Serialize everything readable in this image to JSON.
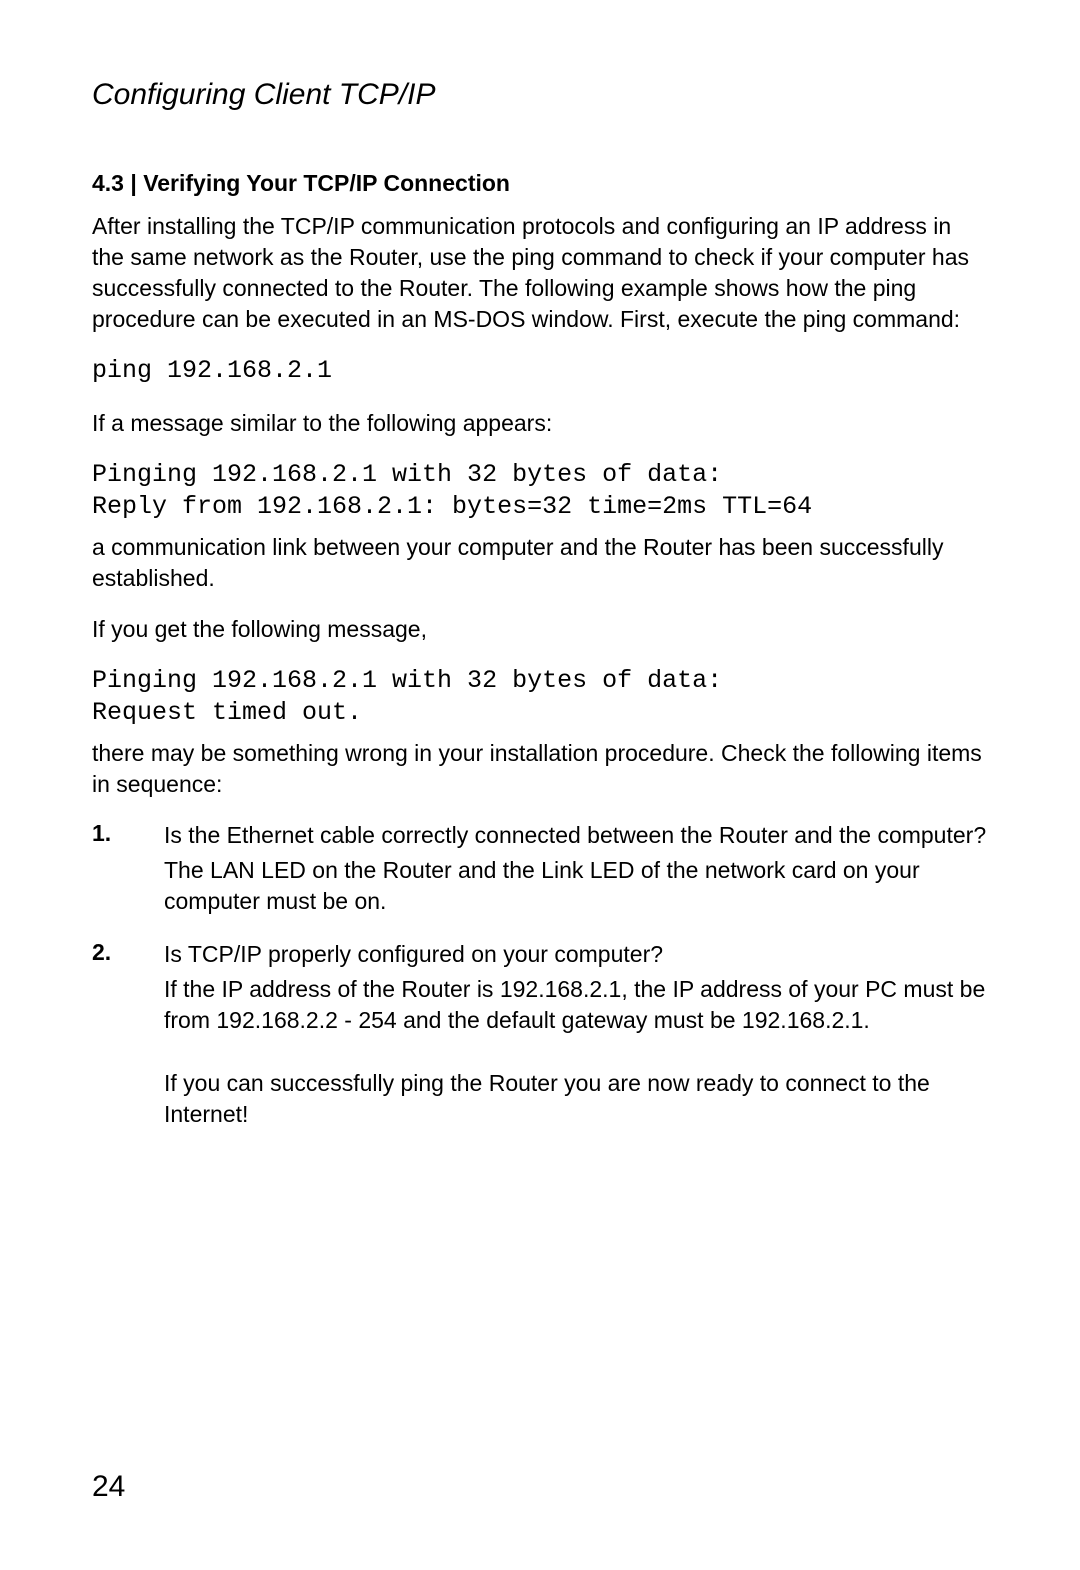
{
  "header": {
    "title": "Configuring Client TCP/IP"
  },
  "section": {
    "heading": "4.3 | Verifying Your TCP/IP Connection",
    "intro_para": "After installing the TCP/IP communication protocols and configuring an IP address in the same network as the Router, use the ping command to check if your computer has successfully connected to the Router. The following example shows how the ping procedure can be executed in an MS-DOS window. First, execute the ping command:",
    "code_ping": "ping 192.168.2.1",
    "if_msg_similar": "If a message similar to the following appears:",
    "code_success": "Pinging 192.168.2.1 with 32 bytes of data:\nReply from 192.168.2.1: bytes=32 time=2ms TTL=64",
    "link_established": "a communication link between your computer and the Router has been successfully established.",
    "if_following": "If you get the following message,",
    "code_fail": "Pinging 192.168.2.1 with 32 bytes of data:\nRequest timed out.",
    "wrong_install": "there may be something wrong in your installation procedure. Check the following items in sequence:"
  },
  "list": {
    "items": [
      {
        "num": "1.",
        "question": "Is the Ethernet cable correctly connected between the Router and the computer?",
        "answer": "The LAN LED on the Router and the Link LED of the network card on your computer must be on."
      },
      {
        "num": "2.",
        "question": "Is TCP/IP properly configured on your computer?",
        "answer": "If the IP address of the Router is 192.168.2.1, the IP address of your PC must be from 192.168.2.2 - 254 and the default gateway must be 192.168.2.1.",
        "extra": "If you can successfully ping the Router you are now ready to connect to the Internet!"
      }
    ]
  },
  "page_number": "24"
}
